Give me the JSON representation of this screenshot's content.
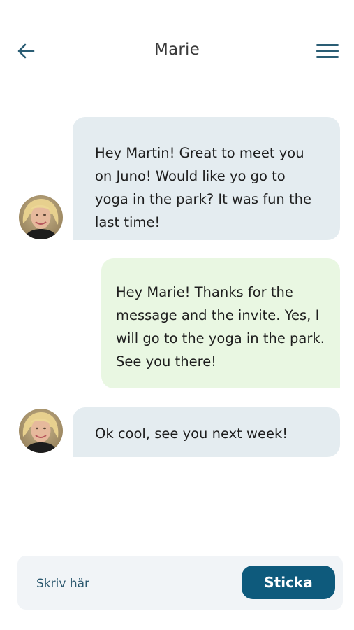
{
  "header": {
    "title": "Marie",
    "back_icon": "arrow-left-icon",
    "menu_icon": "hamburger-menu-icon"
  },
  "messages": [
    {
      "sender": "Marie",
      "direction": "incoming",
      "text": "Hey Martin! Great to meet you on Juno! Would like yo go to yoga in the park? It was fun the last time!"
    },
    {
      "sender": "Martin",
      "direction": "outgoing",
      "text": "Hey Marie! Thanks for the message and the invite. Yes, I will go to the yoga in the park. See you there!"
    },
    {
      "sender": "Marie",
      "direction": "incoming",
      "text": "Ok cool, see you next week!"
    }
  ],
  "composer": {
    "placeholder": "Skriv här",
    "value": "",
    "send_label": "Sticka"
  },
  "colors": {
    "accent": "#0e5a7c",
    "incoming_bubble": "#e4ecf0",
    "outgoing_bubble": "#e9f7e2",
    "composer_bg": "#f1f4f7",
    "icon": "#2a5d74"
  }
}
